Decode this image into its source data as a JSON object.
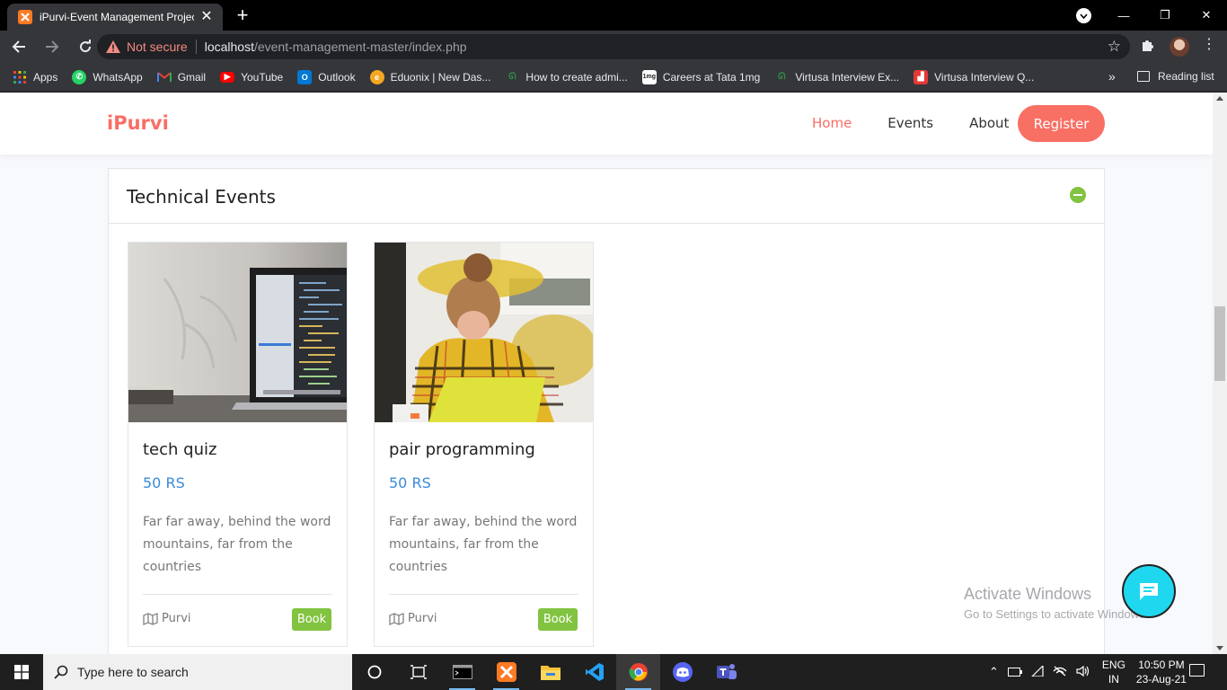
{
  "browser": {
    "tab_title": "iPurvi-Event Management Project",
    "tab_close": "✕",
    "new_tab": "+",
    "security_label": "Not secure",
    "url_host": "localhost",
    "url_path": "/event-management-master/index.php",
    "bookmarks": [
      {
        "label": "Apps",
        "icon": "apps-grid-icon",
        "color": "#ea4335"
      },
      {
        "label": "WhatsApp",
        "icon": "whatsapp-icon",
        "color": "#25d366"
      },
      {
        "label": "Gmail",
        "icon": "gmail-icon",
        "color": "#ea4335"
      },
      {
        "label": "YouTube",
        "icon": "youtube-icon",
        "color": "#ff0000"
      },
      {
        "label": "Outlook",
        "icon": "outlook-icon",
        "color": "#0078d4"
      },
      {
        "label": "Eduonix | New Das...",
        "icon": "eduonix-icon",
        "color": "#f5a623"
      },
      {
        "label": "How to create admi...",
        "icon": "geeksforgeeks-icon",
        "color": "#2f8d46"
      },
      {
        "label": "Careers at Tata 1mg",
        "icon": "tata1mg-icon",
        "color": "#ffffff"
      },
      {
        "label": "Virtusa Interview Ex...",
        "icon": "geeksforgeeks-icon",
        "color": "#2f8d46"
      },
      {
        "label": "Virtusa Interview Q...",
        "icon": "interview-icon",
        "color": "#e53935"
      }
    ],
    "bookmarks_more": "»",
    "reading_list": "Reading list"
  },
  "site": {
    "brand": "iPurvi",
    "nav": [
      {
        "label": "Home",
        "active": true
      },
      {
        "label": "Events",
        "active": false
      },
      {
        "label": "About",
        "active": false
      }
    ],
    "register_label": "Register",
    "accent": "#f86f64",
    "section_title": "Technical Events",
    "events": [
      {
        "title": "tech quiz",
        "price": "50 RS",
        "description": "Far far away, behind the word mountains, far from the countries",
        "organizer": "Purvi",
        "book_label": "Book",
        "image": "laptop-code-photo"
      },
      {
        "title": "pair programming",
        "price": "50 RS",
        "description": "Far far away, behind the word mountains, far from the countries",
        "organizer": "Purvi",
        "book_label": "Book",
        "image": "woman-laptop-photo"
      }
    ],
    "watermark_line1": "Activate Windows",
    "watermark_line2": "Go to Settings to activate Windows."
  },
  "taskbar": {
    "search_placeholder": "Type here to search",
    "apps": [
      "cortana-icon",
      "task-view-icon",
      "terminal-icon",
      "xampp-icon",
      "file-explorer-icon",
      "vscode-icon",
      "chrome-icon",
      "discord-icon",
      "teams-icon"
    ],
    "lang_line1": "ENG",
    "lang_line2": "IN",
    "time": "10:50 PM",
    "date": "23-Aug-21"
  }
}
